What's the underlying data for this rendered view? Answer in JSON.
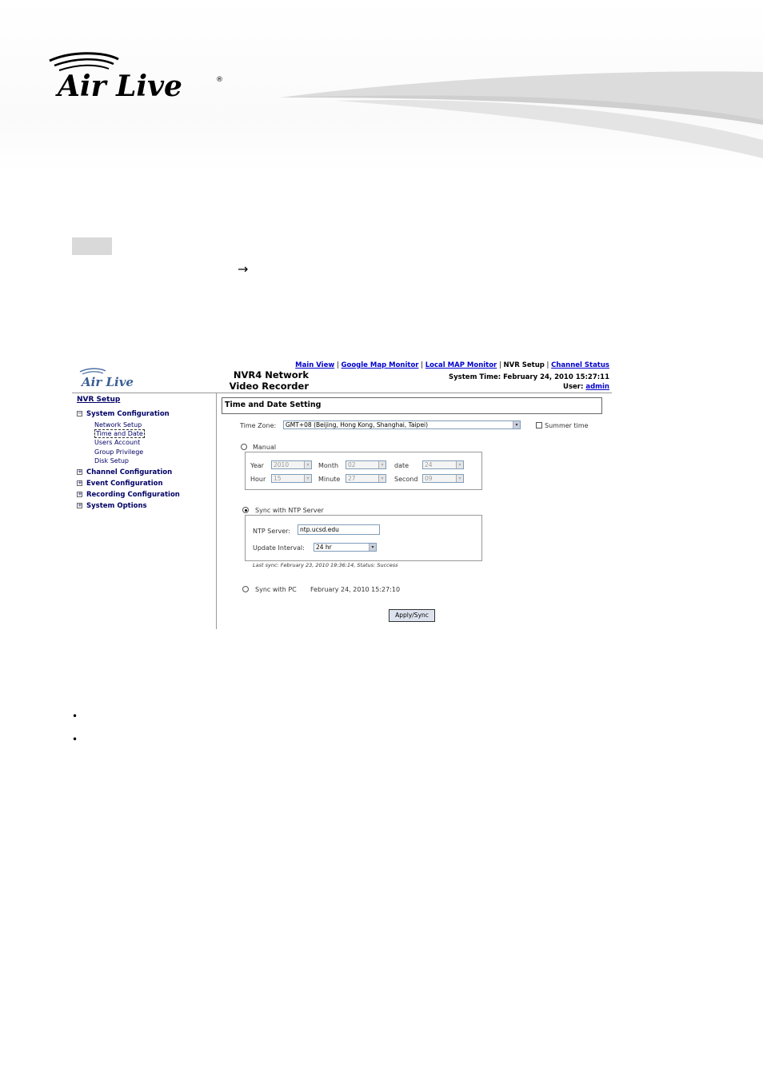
{
  "brand": {
    "logo_text": "Air Live",
    "registered": "®"
  },
  "doc": {
    "arrow": "→",
    "bullets": [
      "•",
      "•"
    ]
  },
  "shot": {
    "logo": "Air Live",
    "title_line1": "NVR4 Network",
    "title_line2": "Video Recorder",
    "nav": {
      "main_view": "Main View",
      "google_map": "Google Map Monitor",
      "local_map": "Local MAP Monitor",
      "nvr_setup": "NVR Setup",
      "channel_status": "Channel Status",
      "separator": "|"
    },
    "system_time_label": "System Time:",
    "system_time_value": "February 24, 2010 15:27:11",
    "user_label": "User:",
    "user_value": "admin",
    "sidebar": {
      "title": "NVR Setup",
      "system_configuration": "System Configuration",
      "sub_items": [
        "Network Setup",
        "Time and Date",
        "Users Account",
        "Group Privilege",
        "Disk Setup"
      ],
      "channel_configuration": "Channel Configuration",
      "event_configuration": "Event Configuration",
      "recording_configuration": "Recording Configuration",
      "system_options": "System Options",
      "expanded_sign": "−",
      "collapsed_sign": "+"
    },
    "panel": {
      "title": "Time and Date Setting",
      "time_zone_label": "Time Zone:",
      "time_zone_value": "GMT+08 (Beijing, Hong Kong, Shanghai, Taipei)",
      "summer_time_label": "Summer time",
      "manual_label": "Manual",
      "year_label": "Year",
      "year_value": "2010",
      "month_label": "Month",
      "month_value": "02",
      "date_label": "date",
      "date_value": "24",
      "hour_label": "Hour",
      "hour_value": "15",
      "minute_label": "Minute",
      "minute_value": "27",
      "second_label": "Second",
      "second_value": "09",
      "ntp_label": "Sync with NTP Server",
      "ntp_server_label": "NTP Server:",
      "ntp_server_value": "ntp.ucsd.edu",
      "update_interval_label": "Update Interval:",
      "update_interval_value": "24 hr",
      "last_sync": "Last sync: February 23, 2010 19:36:14, Status: Success",
      "sync_pc_label": "Sync with PC",
      "sync_pc_value": "February 24, 2010 15:27:10",
      "apply_label": "Apply/Sync",
      "dropdown_glyph": "▾"
    }
  }
}
